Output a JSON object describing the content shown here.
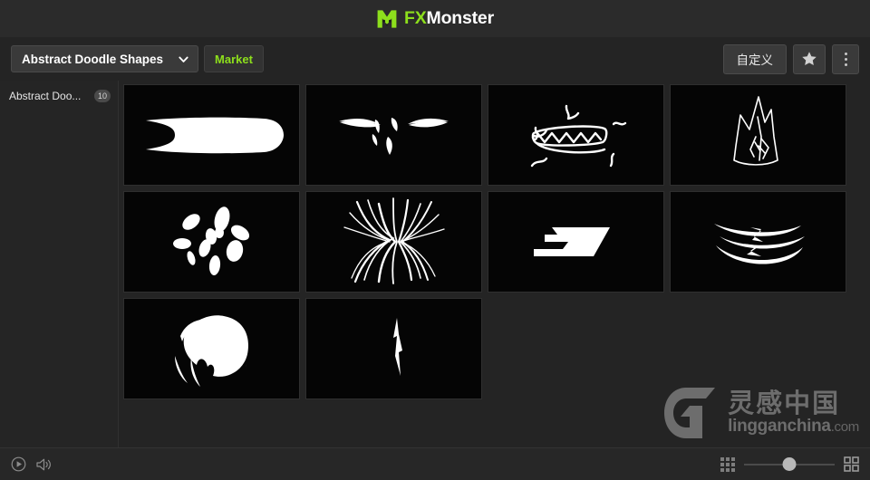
{
  "titlebar": {
    "brand_prefix": "FX",
    "brand_suffix": "Monster",
    "logo_icon": "monster-m-logo",
    "accent_color": "#8ddf1c"
  },
  "toolbar": {
    "preset_label": "Abstract Doodle Shapes",
    "preset_chevron_icon": "chevron-down-icon",
    "market_label": "Market",
    "customize_label": "自定义",
    "favorite_icon": "star-icon",
    "more_icon": "kebab-menu-icon"
  },
  "sidebar": {
    "items": [
      {
        "label": "Abstract Doo...",
        "badge": "10"
      }
    ]
  },
  "grid": {
    "items": [
      {
        "name": "rounded-swipe-bar-shape",
        "icon": "doodle-swipe-bar"
      },
      {
        "name": "scribble-brows-shape",
        "icon": "doodle-brows"
      },
      {
        "name": "toothy-mouth-doodle",
        "icon": "doodle-teeth-mouth"
      },
      {
        "name": "spiky-crown-outline",
        "icon": "doodle-spiky-crown"
      },
      {
        "name": "ink-splatter-shape",
        "icon": "doodle-splatter"
      },
      {
        "name": "tendril-wisps-shape",
        "icon": "doodle-tendrils"
      },
      {
        "name": "arrow-block-shape",
        "icon": "doodle-arrow-block"
      },
      {
        "name": "stacked-arcs-shape",
        "icon": "doodle-arcs"
      },
      {
        "name": "scribble-blob-shape",
        "icon": "doodle-blob"
      },
      {
        "name": "thin-spike-shape",
        "icon": "doodle-spike"
      }
    ]
  },
  "watermark": {
    "cn_text": "灵感中国",
    "en_text": "lingganchina",
    "tld_text": ".com",
    "logo_icon": "lingganchina-logo"
  },
  "bottombar": {
    "play_icon": "play-circle-icon",
    "volume_icon": "speaker-icon",
    "small_grid_icon": "grid-3x3-icon",
    "large_grid_icon": "grid-2x2-icon",
    "zoom_value": 50
  }
}
